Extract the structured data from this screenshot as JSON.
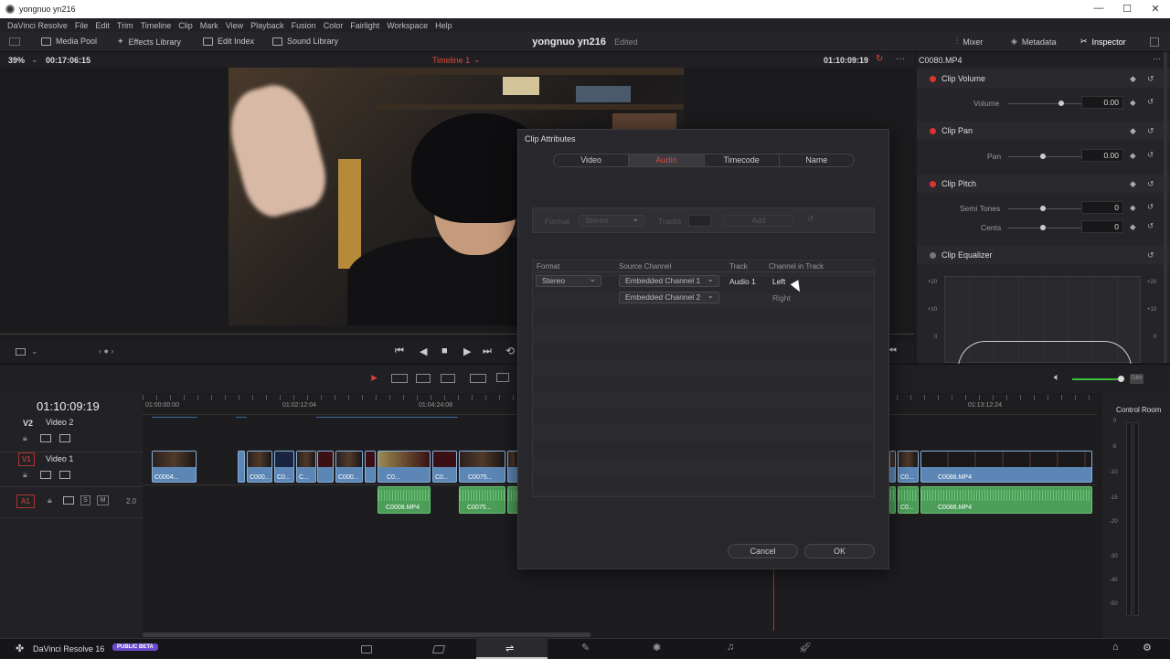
{
  "window": {
    "title": "yongnuo yn216"
  },
  "menu": [
    "DaVinci Resolve",
    "File",
    "Edit",
    "Trim",
    "Timeline",
    "Clip",
    "Mark",
    "View",
    "Playback",
    "Fusion",
    "Color",
    "Fairlight",
    "Workspace",
    "Help"
  ],
  "toolbar": {
    "media_pool": "Media Pool",
    "effects_library": "Effects Library",
    "edit_index": "Edit Index",
    "sound_library": "Sound Library",
    "project_name": "yongnuo yn216",
    "project_status": "Edited",
    "mixer": "Mixer",
    "metadata": "Metadata",
    "inspector": "Inspector"
  },
  "viewer": {
    "zoom": "39%",
    "duration": "00:17:06:15",
    "timeline_name": "Timeline 1",
    "timecode": "01:10:09:19"
  },
  "inspector": {
    "clip_name": "C0080.MP4",
    "clip_volume": "Clip Volume",
    "volume_label": "Volume",
    "volume_value": "0.00",
    "clip_pan": "Clip Pan",
    "pan_label": "Pan",
    "pan_value": "0.00",
    "clip_pitch": "Clip Pitch",
    "semitones_label": "Semi Tones",
    "semitones_value": "0",
    "cents_label": "Cents",
    "cents_value": "0",
    "clip_equalizer": "Clip Equalizer",
    "eq_labels": [
      "+20",
      "+10",
      "0"
    ]
  },
  "timeline": {
    "timecode": "01:10:09:19",
    "ruler": [
      "01:00:00:00",
      "01:02:12:04",
      "01:04:24:08",
      "01:13:12:24"
    ],
    "tracks": {
      "v2": {
        "id": "V2",
        "name": "Video 2"
      },
      "v1": {
        "id": "V1",
        "name": "Video 1"
      },
      "a1": {
        "id": "A1",
        "channels": "2.0"
      }
    },
    "video_clips": [
      "C0004...",
      "C000...",
      "C0...",
      "C...",
      "C000...",
      "C0...",
      "C0...",
      "C0075...",
      "C0...",
      "C0086.MP4"
    ],
    "audio_clips": [
      "C0008.MP4",
      "C0075...",
      "C0...",
      "C0086.MP4"
    ],
    "control_room": "Control Room",
    "meter_scale": [
      "0",
      "-5",
      "-10",
      "-15",
      "-20",
      "-30",
      "-40",
      "-50"
    ]
  },
  "dialog": {
    "title": "Clip Attributes",
    "tabs": [
      "Video",
      "Audio",
      "Timecode",
      "Name"
    ],
    "active_tab": "Audio",
    "top_format_label": "Format",
    "top_format_value": "Stereo",
    "top_tracks_label": "Tracks",
    "add_button": "Add",
    "headers": {
      "format": "Format",
      "source_channel": "Source Channel",
      "track": "Track",
      "channel_in_track": "Channel in Track"
    },
    "rows": [
      {
        "format": "Stereo",
        "source": "Embedded Channel 1",
        "track": "Audio 1",
        "channel": "Left"
      },
      {
        "format": "",
        "source": "Embedded Channel 2",
        "track": "",
        "channel": "Right"
      }
    ],
    "cancel": "Cancel",
    "ok": "OK"
  },
  "pagebar": {
    "app_name": "DaVinci Resolve 16",
    "badge": "PUBLIC BETA"
  },
  "colors": {
    "accent_red": "#e0483c",
    "clip_blue": "#5c86b5",
    "clip_green": "#4b9d57",
    "badge_purple": "#6a4bcf"
  }
}
